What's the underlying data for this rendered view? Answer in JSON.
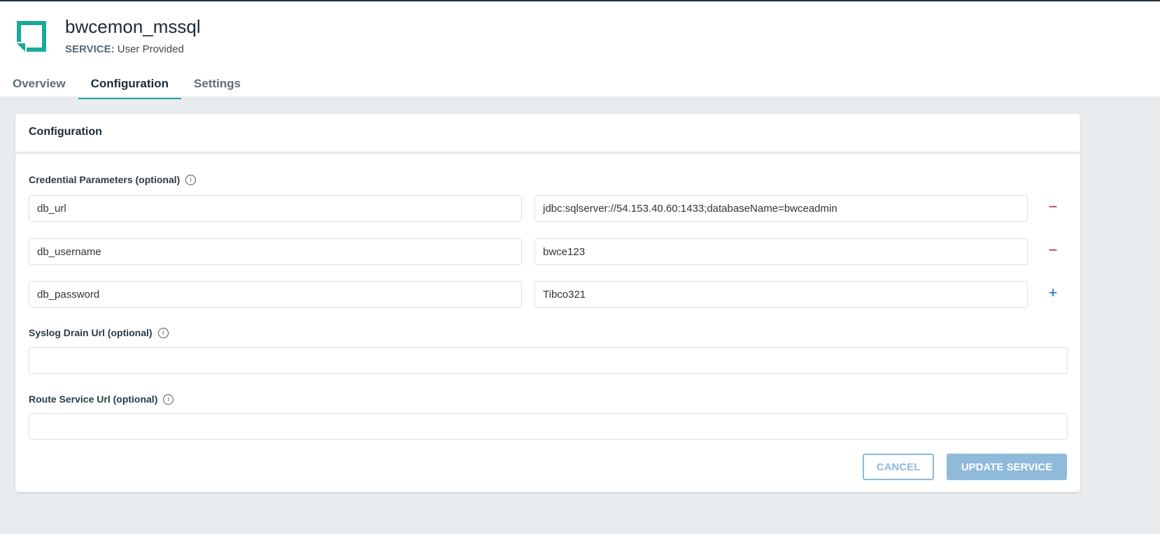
{
  "header": {
    "title": "bwcemon_mssql",
    "service_label": "SERVICE:",
    "service_value": "User Provided"
  },
  "tabs": [
    {
      "label": "Overview"
    },
    {
      "label": "Configuration",
      "active": true
    },
    {
      "label": "Settings"
    }
  ],
  "card": {
    "title": "Configuration",
    "credential_label": "Credential Parameters (optional)",
    "params": [
      {
        "key": "db_url",
        "value": "jdbc:sqlserver://54.153.40.60:1433;databaseName=bwceadmin",
        "action": "−"
      },
      {
        "key": "db_username",
        "value": "bwce123",
        "action": "−"
      },
      {
        "key": "db_password",
        "value": "Tibco321",
        "action": "+"
      }
    ],
    "syslog_label": "Syslog Drain Url (optional)",
    "syslog_value": "",
    "route_label": "Route Service Url (optional)",
    "route_value": "",
    "cancel": "CANCEL",
    "update": "UPDATE SERVICE"
  },
  "info_glyph": "i",
  "colors": {
    "accent": "#1aa99a",
    "button": "#8fbad9",
    "remove": "#c0201a",
    "add": "#1a6cb8"
  }
}
